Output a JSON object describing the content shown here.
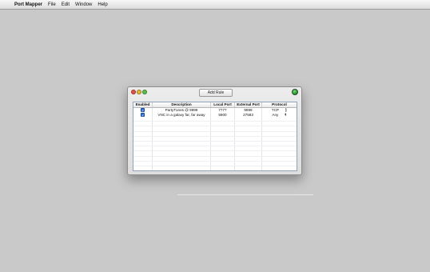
{
  "menubar": {
    "apple_icon": "apple-icon",
    "app_name": "Port Mapper",
    "items": [
      "File",
      "Edit",
      "Window",
      "Help"
    ]
  },
  "window": {
    "add_rule_label": "Add Rule",
    "status_color": "#1f8d22"
  },
  "table": {
    "headers": [
      "Enabled",
      "Description",
      "Local Port",
      "External Port",
      "Protocol"
    ],
    "rows": [
      {
        "enabled": true,
        "description": "PartyTunes @ 9999",
        "local_port": "7777",
        "external_port": "9999",
        "protocol": "TCP"
      },
      {
        "enabled": true,
        "description": "VNC in a galaxy far, far away",
        "local_port": "5900",
        "external_port": "27583",
        "protocol": "Any"
      }
    ]
  }
}
